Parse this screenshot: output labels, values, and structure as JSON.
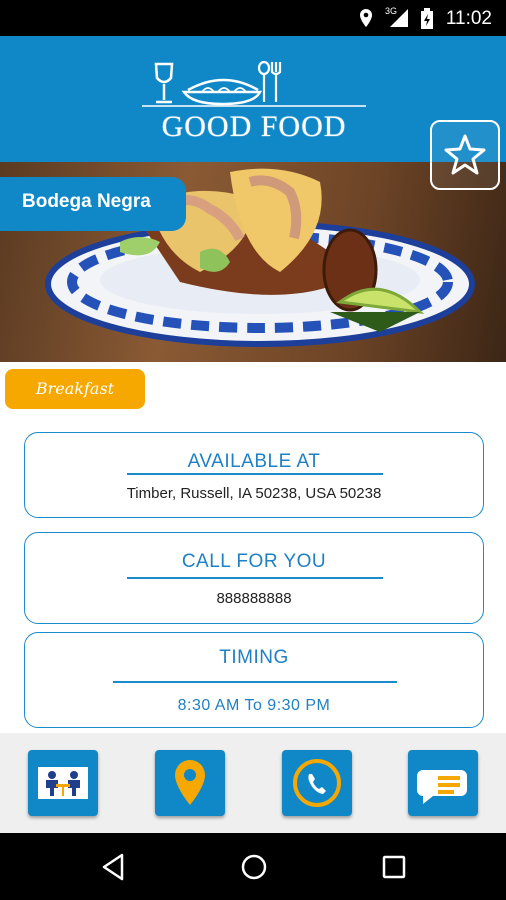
{
  "status_bar": {
    "time": "11:02",
    "network_label": "3G"
  },
  "header": {
    "logo_text": "GOOD FOOD"
  },
  "restaurant": {
    "name": "Bodega Negra",
    "category": "Breakfast"
  },
  "cards": {
    "available": {
      "heading": "AVAILABLE AT",
      "value": "Timber, Russell, IA 50238, USA 50238"
    },
    "call": {
      "heading": "CALL FOR YOU",
      "value": "888888888"
    },
    "timing": {
      "heading": "TIMING",
      "value": "8:30 AM To 9:30 PM"
    }
  },
  "bottom_tabs": [
    {
      "icon": "dining-people-icon"
    },
    {
      "icon": "location-pin-icon"
    },
    {
      "icon": "phone-icon"
    },
    {
      "icon": "chat-icon"
    }
  ],
  "colors": {
    "primary": "#1088c7",
    "accent": "#f6a800",
    "card_border": "#1a8ccc"
  }
}
